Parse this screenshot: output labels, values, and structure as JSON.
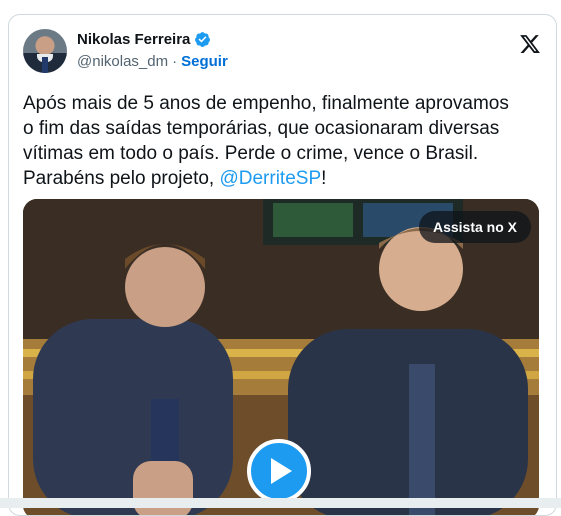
{
  "author": {
    "name": "Nikolas Ferreira",
    "handle": "@nikolas_dm",
    "separator": "·",
    "follow_label": "Seguir",
    "verified_color": "#1d9bf0"
  },
  "icons": {
    "logo": "x-logo-icon",
    "verified": "verified-badge-icon",
    "play": "play-icon"
  },
  "tweet": {
    "text_lines": [
      "Após mais de 5 anos de empenho, finalmente aprovamos",
      "o fim das saídas temporárias, que ocasionaram diversas",
      "vítimas em todo o país. Perde o crime, vence o Brasil.",
      "Parabéns pelo projeto, "
    ],
    "mention": "@DerriteSP",
    "trailing": "!"
  },
  "media": {
    "watch_label": "Assista no X"
  },
  "colors": {
    "accent": "#1d9bf0",
    "text": "#0f1419",
    "muted": "#536471",
    "follow": "#006fd6"
  }
}
